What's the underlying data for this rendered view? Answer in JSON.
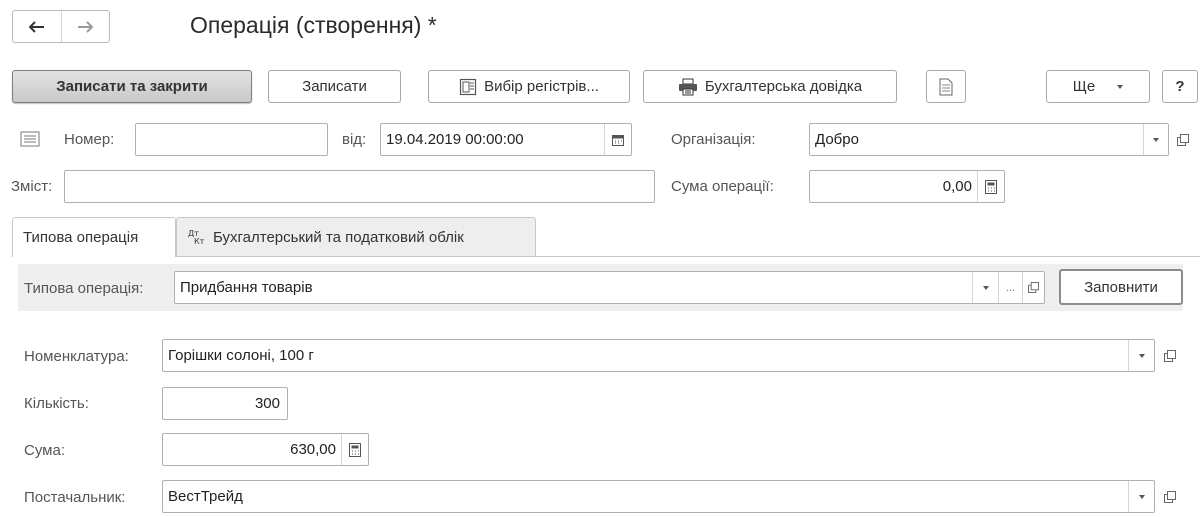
{
  "window": {
    "title": "Операція (створення) *"
  },
  "nav": {
    "back_icon": "arrow-left-icon",
    "forward_icon": "arrow-right-icon"
  },
  "toolbar": {
    "save_close": "Записати та закрити",
    "save": "Записати",
    "registers": "Вибір регістрів...",
    "accounting_report": "Бухгалтерська довідка",
    "more": "Ще",
    "help": "?"
  },
  "header": {
    "number_label": "Номер:",
    "number_value": "",
    "date_label": "від:",
    "date_value": "19.04.2019 00:00:00",
    "org_label": "Організація:",
    "org_value": "Добро",
    "content_label": "Зміст:",
    "content_value": "",
    "amount_label": "Сума операції:",
    "amount_value": "0,00"
  },
  "tabs": [
    {
      "label": "Типова операція"
    },
    {
      "label": "Бухгалтерський та податковий облік",
      "icon": "dt-kt-icon"
    }
  ],
  "typical_op": {
    "label": "Типова операція:",
    "value": "Придбання товарів",
    "ellipsis": "...",
    "fill_button": "Заповнити"
  },
  "details": {
    "nomenclature_label": "Номенклатура:",
    "nomenclature_value": "Горішки солоні, 100 г",
    "quantity_label": "Кількість:",
    "quantity_value": "300",
    "sum_label": "Сума:",
    "sum_value": "630,00",
    "supplier_label": "Постачальник:",
    "supplier_value": "ВестТрейд"
  },
  "colors": {
    "primary_button_bg": "#cfcfcf",
    "border": "#b0b0b0",
    "panel_bg": "#efefef",
    "inactive_tab_bg": "#eeeeee"
  }
}
